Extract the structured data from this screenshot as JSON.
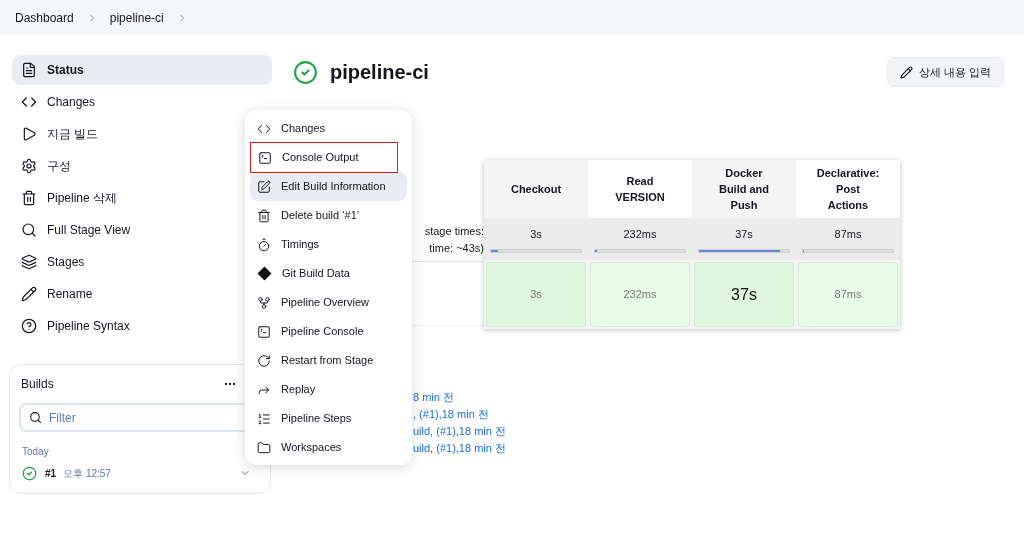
{
  "breadcrumb": [
    "Dashboard",
    "pipeline-ci"
  ],
  "sidebar": {
    "items": [
      {
        "label": "Status",
        "selected": true
      },
      {
        "label": "Changes",
        "selected": false
      },
      {
        "label": "지금 빌드",
        "selected": false
      },
      {
        "label": "구성",
        "selected": false
      },
      {
        "label": "Pipeline 삭제",
        "selected": false
      },
      {
        "label": "Full Stage View",
        "selected": false
      },
      {
        "label": "Stages",
        "selected": false
      },
      {
        "label": "Rename",
        "selected": false
      },
      {
        "label": "Pipeline Syntax",
        "selected": false
      }
    ]
  },
  "builds": {
    "title": "Builds",
    "filter": {
      "placeholder": "Filter"
    },
    "group": "Today",
    "rows": [
      {
        "number": "#1",
        "time": "오후 12:57",
        "succeeded": true
      }
    ]
  },
  "job": {
    "title": "pipeline-ci",
    "succeeded": true,
    "edit_button": "상세 내용 입력"
  },
  "stage_view": {
    "labels": [
      "stage times:",
      "time: ~43s)"
    ],
    "stages": [
      {
        "name": "Checkout",
        "avg": "3s",
        "level": 0.08,
        "duration": "3s",
        "emphasized": false
      },
      {
        "name": "Read VERSION",
        "avg": "232ms",
        "level": 0.02,
        "duration": "232ms",
        "emphasized": false
      },
      {
        "name": "Docker Build and Push",
        "avg": "37s",
        "level": 0.9,
        "duration": "37s",
        "emphasized": true
      },
      {
        "name": "Declarative: Post Actions",
        "avg": "87ms",
        "level": 0.01,
        "duration": "87ms",
        "emphasized": false
      }
    ]
  },
  "links": [
    "8 min 전",
    ", (#1),18 min 전",
    "uild, (#1),18 min 전",
    "uild, (#1),18 min 전"
  ],
  "context_menu": {
    "items": [
      {
        "label": "Changes",
        "highlighted": false,
        "outlined": false
      },
      {
        "label": "Console Output",
        "highlighted": false,
        "outlined": true
      },
      {
        "label": "Edit Build Information",
        "highlighted": true,
        "outlined": false
      },
      {
        "label": "Delete build ‘#1’",
        "highlighted": false,
        "outlined": false
      },
      {
        "label": "Timings",
        "highlighted": false,
        "outlined": false
      },
      {
        "label": "Git Build Data",
        "highlighted": false,
        "outlined": false
      },
      {
        "label": "Pipeline Overview",
        "highlighted": false,
        "outlined": false
      },
      {
        "label": "Pipeline Console",
        "highlighted": false,
        "outlined": false
      },
      {
        "label": "Restart from Stage",
        "highlighted": false,
        "outlined": false
      },
      {
        "label": "Replay",
        "highlighted": false,
        "outlined": false
      },
      {
        "label": "Pipeline Steps",
        "highlighted": false,
        "outlined": false
      },
      {
        "label": "Workspaces",
        "highlighted": false,
        "outlined": false
      }
    ]
  }
}
